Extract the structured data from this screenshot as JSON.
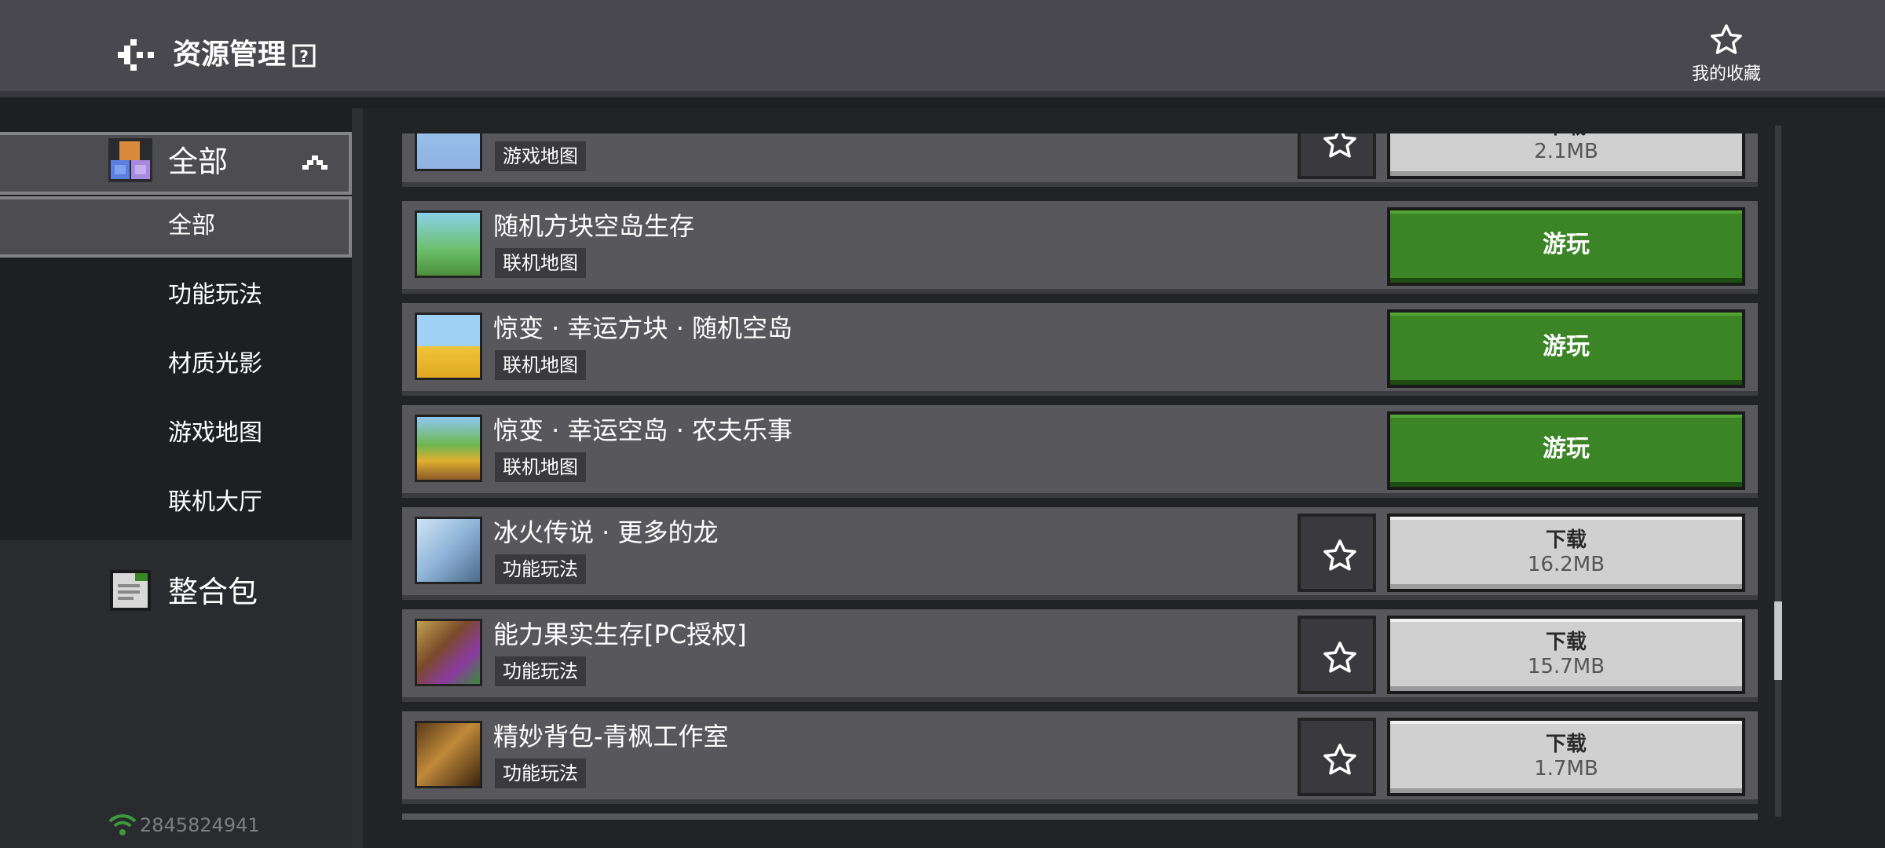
{
  "header": {
    "title": "资源管理",
    "favorites_label": "我的收藏"
  },
  "sidebar": {
    "category_all": "全部",
    "sub_items": [
      {
        "label": "全部",
        "selected": true
      },
      {
        "label": "功能玩法",
        "selected": false
      },
      {
        "label": "材质光影",
        "selected": false
      },
      {
        "label": "游戏地图",
        "selected": false
      },
      {
        "label": "联机大厅",
        "selected": false
      }
    ],
    "packs_label": "整合包",
    "account_id": "2845824941"
  },
  "list": {
    "items": [
      {
        "title": "",
        "tag": "游戏地图",
        "action": "download",
        "action_label": "下载",
        "size": "2.1MB"
      },
      {
        "title": "随机方块空岛生存",
        "tag": "联机地图",
        "action": "play",
        "action_label": "游玩"
      },
      {
        "title": "惊变 · 幸运方块 · 随机空岛",
        "tag": "联机地图",
        "action": "play",
        "action_label": "游玩"
      },
      {
        "title": "惊变 · 幸运空岛 · 农夫乐事",
        "tag": "联机地图",
        "action": "play",
        "action_label": "游玩"
      },
      {
        "title": "冰火传说 · 更多的龙",
        "tag": "功能玩法",
        "action": "download",
        "action_label": "下载",
        "size": "16.2MB"
      },
      {
        "title": "能力果实生存[PC授权]",
        "tag": "功能玩法",
        "action": "download",
        "action_label": "下载",
        "size": "15.7MB"
      },
      {
        "title": "精妙背包-青枫工作室",
        "tag": "功能玩法",
        "action": "download",
        "action_label": "下载",
        "size": "1.7MB"
      }
    ]
  },
  "colors": {
    "header_bg": "#48484e",
    "card_bg": "#58585c",
    "play_green": "#3c8527",
    "download_gray": "#d0d0d0",
    "wifi_green": "#3c9a3a"
  }
}
